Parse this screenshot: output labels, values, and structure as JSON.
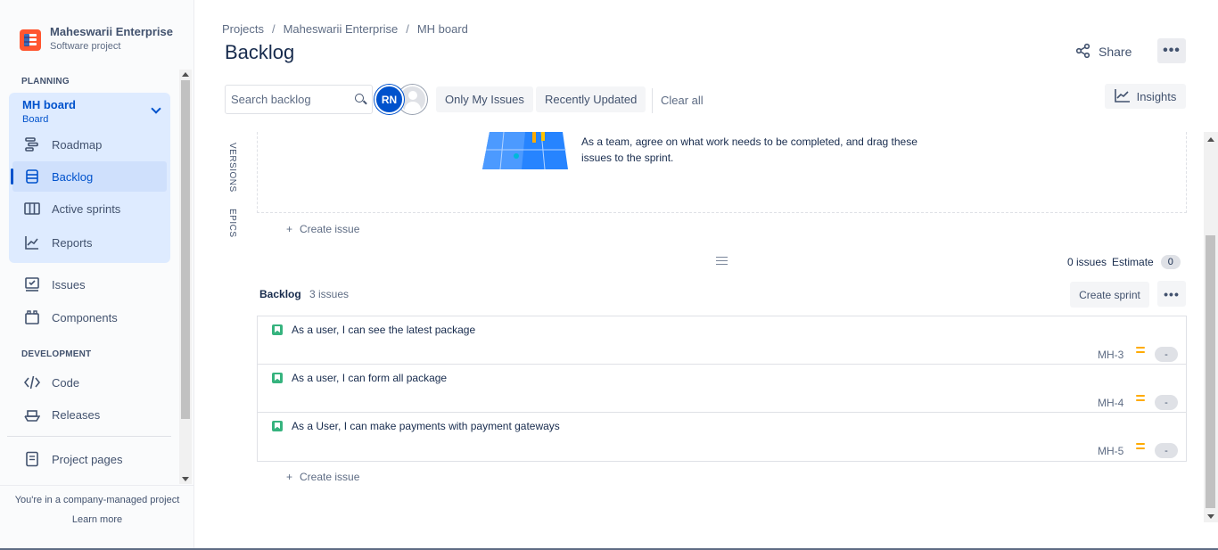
{
  "project": {
    "name": "Maheswarii Enterprise",
    "type": "Software project"
  },
  "sidebar": {
    "planning_label": "PLANNING",
    "board": {
      "name": "MH board",
      "sub": "Board"
    },
    "board_items": [
      {
        "label": "Roadmap",
        "icon": "roadmap-icon"
      },
      {
        "label": "Backlog",
        "icon": "backlog-icon"
      },
      {
        "label": "Active sprints",
        "icon": "board-columns-icon"
      },
      {
        "label": "Reports",
        "icon": "chart-line-icon"
      }
    ],
    "other_items": [
      {
        "label": "Issues",
        "icon": "issues-icon"
      },
      {
        "label": "Components",
        "icon": "components-icon"
      }
    ],
    "development_label": "DEVELOPMENT",
    "dev_items": [
      {
        "label": "Code",
        "icon": "code-icon"
      },
      {
        "label": "Releases",
        "icon": "ship-icon"
      }
    ],
    "project_pages": "Project pages",
    "footer_text": "You're in a company-managed project",
    "learn_more": "Learn more"
  },
  "breadcrumb": [
    "Projects",
    "Maheswarii Enterprise",
    "MH board"
  ],
  "page_title": "Backlog",
  "header": {
    "share": "Share",
    "more": "•••"
  },
  "toolbar": {
    "search_placeholder": "Search backlog",
    "avatar_initials": "RN",
    "only_my_issues": "Only My Issues",
    "recently_updated": "Recently Updated",
    "clear_all": "Clear all",
    "insights": "Insights"
  },
  "side_tabs": {
    "versions": "VERSIONS",
    "epics": "EPICS"
  },
  "sprint": {
    "empty_text": "As a team, agree on what work needs to be completed, and drag these issues to the sprint.",
    "create_issue": "Create issue"
  },
  "stats": {
    "issues": "0 issues",
    "estimate_label": "Estimate",
    "estimate_value": "0"
  },
  "backlog": {
    "title": "Backlog",
    "count": "3 issues",
    "create_sprint": "Create sprint",
    "more": "•••",
    "issues": [
      {
        "summary": "As a user, I can see the latest package",
        "key": "MH-3",
        "estimate": "-",
        "priority": "medium"
      },
      {
        "summary": "As a user, I can form all package",
        "key": "MH-4",
        "estimate": "-",
        "priority": "medium"
      },
      {
        "summary": "As a User, I can make payments with payment gateways",
        "key": "MH-5",
        "estimate": "-",
        "priority": "medium"
      }
    ],
    "create_issue": "Create issue"
  },
  "colors": {
    "accent": "#0052cc",
    "story": "#36b37e",
    "priority_medium": "#ffab00",
    "logo": "#ff5630"
  }
}
